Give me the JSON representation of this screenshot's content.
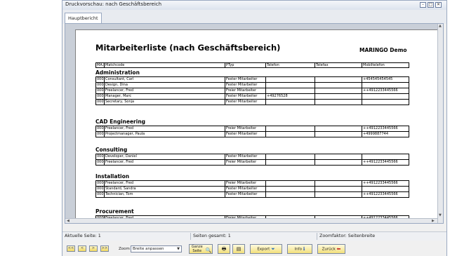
{
  "window": {
    "title": "Druckvorschau: nach Geschäftsbereich",
    "minimize": "–",
    "maximize": "□",
    "close": "✕"
  },
  "tabs": [
    {
      "label": "Hauptbericht"
    }
  ],
  "report": {
    "title": "Mitarbeiterliste (nach Geschäftsbereich)",
    "company": "MARINGO Demo",
    "columns": [
      "MA.Nr.",
      "Matchcode",
      "PTyp",
      "Telefon",
      "Telefax",
      "Mobiltelefon"
    ],
    "groups": [
      {
        "name": "Administration",
        "rows": [
          [
            "0005",
            "Consultant, Carl",
            "Fester Mitarbeiter",
            "",
            "",
            "+454545454545"
          ],
          [
            "0008",
            "Design, Dina",
            "Fester Mitarbeiter",
            "",
            "",
            ""
          ],
          [
            "0004",
            "Freelancer, Fred",
            "Freier Mitarbeiter",
            "",
            "",
            "++4912233445566"
          ],
          [
            "0001",
            "Manager, Marc",
            "Fester Mitarbeiter",
            "+49276528",
            "",
            ""
          ],
          [
            "0009",
            "Secretary, Sonja",
            "Fester Mitarbeiter",
            "",
            "",
            ""
          ]
        ]
      },
      {
        "name": "CAD Engineering",
        "rows": [
          [
            "0004",
            "Freelancer, Fred",
            "Freier Mitarbeiter",
            "",
            "",
            "++4912233445566"
          ],
          [
            "0002",
            "Projectmanager, Paula",
            "Fester Mitarbeiter",
            "",
            "",
            "+4999887744"
          ]
        ]
      },
      {
        "name": "Consulting",
        "rows": [
          [
            "0006",
            "Developer, Daniel",
            "Fester Mitarbeiter",
            "",
            "",
            ""
          ],
          [
            "0004",
            "Freelancer, Fred",
            "Freier Mitarbeiter",
            "",
            "",
            "++4912233445566"
          ]
        ]
      },
      {
        "name": "Installation",
        "rows": [
          [
            "0004",
            "Freelancer, Fred",
            "Freier Mitarbeiter",
            "",
            "",
            "++4912233445566"
          ],
          [
            "0003",
            "Standard, Sandra",
            "Fester Mitarbeiter",
            "",
            "",
            ""
          ],
          [
            "0007",
            "Technician, Tom",
            "Fester Mitarbeiter",
            "",
            "",
            "++4912233445566"
          ]
        ]
      },
      {
        "name": "Procurement",
        "rows": [
          [
            "0004",
            "Freelancer, Fred",
            "Freier Mitarbeiter",
            "",
            "",
            "++4912233445566"
          ]
        ]
      }
    ]
  },
  "status": {
    "current_page": "Aktuelle Seite: 1",
    "total_pages": "Seiten gesamt: 1",
    "zoom_factor": "Zoomfaktor: Seitenbreite"
  },
  "toolbar": {
    "first": "<<",
    "prev": "<",
    "next": ">",
    "last": ">>",
    "zoom_label": "Zoom",
    "zoom_value": "Breite anpassen",
    "whole_page": "Ganze Seite",
    "export": "Export",
    "info": "Info",
    "back": "Zurück"
  },
  "icons": [
    "print-icon",
    "print-setup-icon",
    "export-funnel-icon",
    "info-icon",
    "back-arrow-icon",
    "magnifier-icon"
  ],
  "colors": {
    "button_yellow": "#f2df7a",
    "window_border": "#9aa9c1",
    "preview_bg": "#c9cfd8"
  }
}
